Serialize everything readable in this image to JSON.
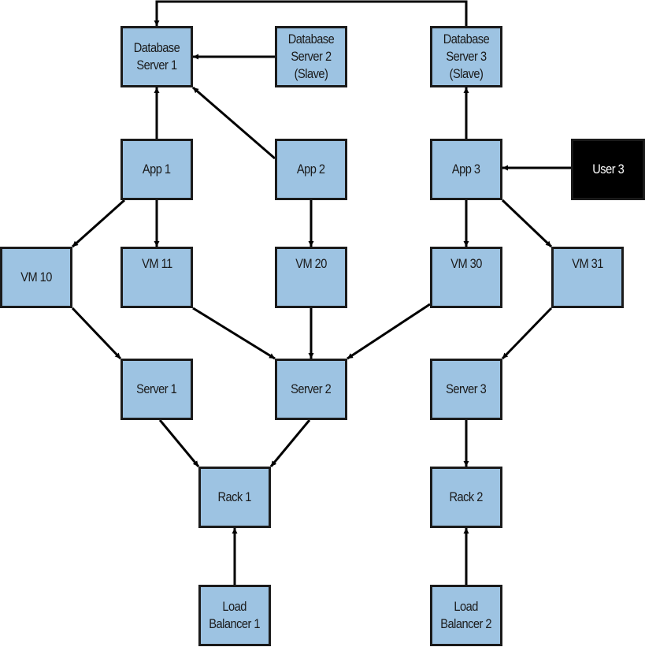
{
  "diagram": {
    "title": "",
    "colors": {
      "node_fill": "#9dc3e2",
      "node_border": "#1a1a1a",
      "highlight_fill": "#000000",
      "highlight_text": "#ffffff",
      "edge": "#000000"
    },
    "nodes": [
      {
        "id": "db1",
        "label": "Database\nServer 1",
        "style": "light"
      },
      {
        "id": "db2",
        "label": "Database\nServer 2\n(Slave)",
        "style": "light"
      },
      {
        "id": "db3",
        "label": "Database\nServer 3\n(Slave)",
        "style": "light"
      },
      {
        "id": "app1",
        "label": "App 1",
        "style": "light"
      },
      {
        "id": "app2",
        "label": "App 2",
        "style": "light"
      },
      {
        "id": "app3",
        "label": "App 3",
        "style": "light"
      },
      {
        "id": "user3",
        "label": "User 3",
        "style": "dark"
      },
      {
        "id": "vm10",
        "label": "VM 10",
        "style": "light"
      },
      {
        "id": "vm11",
        "label": "VM 11",
        "style": "light"
      },
      {
        "id": "vm20",
        "label": "VM 20",
        "style": "light"
      },
      {
        "id": "vm30",
        "label": "VM 30",
        "style": "light"
      },
      {
        "id": "vm31",
        "label": "VM 31",
        "style": "light"
      },
      {
        "id": "server1",
        "label": "Server 1",
        "style": "light"
      },
      {
        "id": "server2",
        "label": "Server 2",
        "style": "light"
      },
      {
        "id": "server3",
        "label": "Server 3",
        "style": "light"
      },
      {
        "id": "rack1",
        "label": "Rack 1",
        "style": "light"
      },
      {
        "id": "rack2",
        "label": "Rack 2",
        "style": "light"
      },
      {
        "id": "lb1",
        "label": "Load\nBalancer 1",
        "style": "light"
      },
      {
        "id": "lb2",
        "label": "Load\nBalancer 2",
        "style": "light"
      }
    ],
    "edges": [
      {
        "from": "db3",
        "to": "db1"
      },
      {
        "from": "db2",
        "to": "db1"
      },
      {
        "from": "app1",
        "to": "db1"
      },
      {
        "from": "app2",
        "to": "db1"
      },
      {
        "from": "app3",
        "to": "db3"
      },
      {
        "from": "user3",
        "to": "app3"
      },
      {
        "from": "app1",
        "to": "vm10"
      },
      {
        "from": "app1",
        "to": "vm11"
      },
      {
        "from": "app2",
        "to": "vm20"
      },
      {
        "from": "app3",
        "to": "vm30"
      },
      {
        "from": "app3",
        "to": "vm31"
      },
      {
        "from": "vm10",
        "to": "server1"
      },
      {
        "from": "vm11",
        "to": "server2"
      },
      {
        "from": "vm20",
        "to": "server2"
      },
      {
        "from": "vm30",
        "to": "server2"
      },
      {
        "from": "vm31",
        "to": "server3"
      },
      {
        "from": "server1",
        "to": "rack1"
      },
      {
        "from": "server2",
        "to": "rack1"
      },
      {
        "from": "server3",
        "to": "rack2"
      },
      {
        "from": "lb1",
        "to": "rack1"
      },
      {
        "from": "lb2",
        "to": "rack2"
      }
    ]
  }
}
